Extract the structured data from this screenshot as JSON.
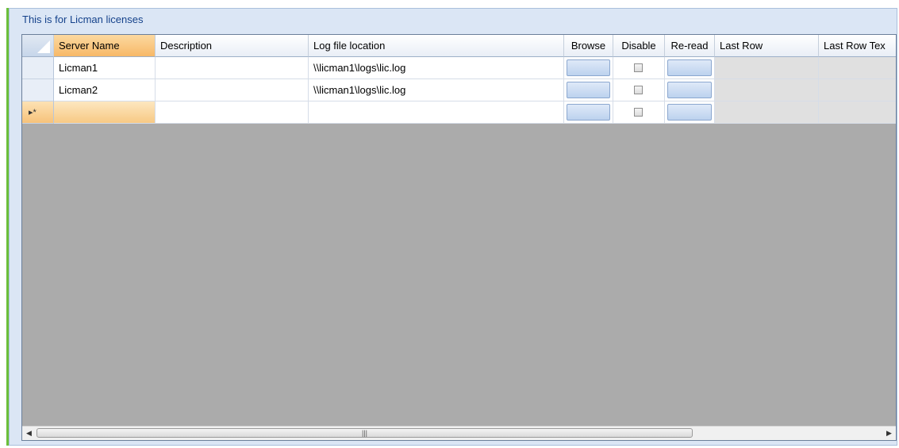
{
  "panel": {
    "caption": "This is for Licman licenses"
  },
  "grid": {
    "columns": {
      "server_name": "Server Name",
      "description": "Description",
      "log_file_location": "Log file location",
      "browse": "Browse",
      "disable": "Disable",
      "reread": "Re-read",
      "last_row": "Last Row",
      "last_row_text": "Last Row Tex"
    },
    "rows": [
      {
        "server_name": "Licman1",
        "description": "",
        "log_file_location": "\\\\licman1\\logs\\lic.log",
        "disabled": false
      },
      {
        "server_name": "Licman2",
        "description": "",
        "log_file_location": "\\\\licman1\\logs\\lic.log",
        "disabled": false
      }
    ],
    "new_row_indicator": "▸*"
  },
  "scrollbar": {
    "left_arrow": "◀",
    "right_arrow": "▶",
    "thumb_grip": "|||"
  }
}
